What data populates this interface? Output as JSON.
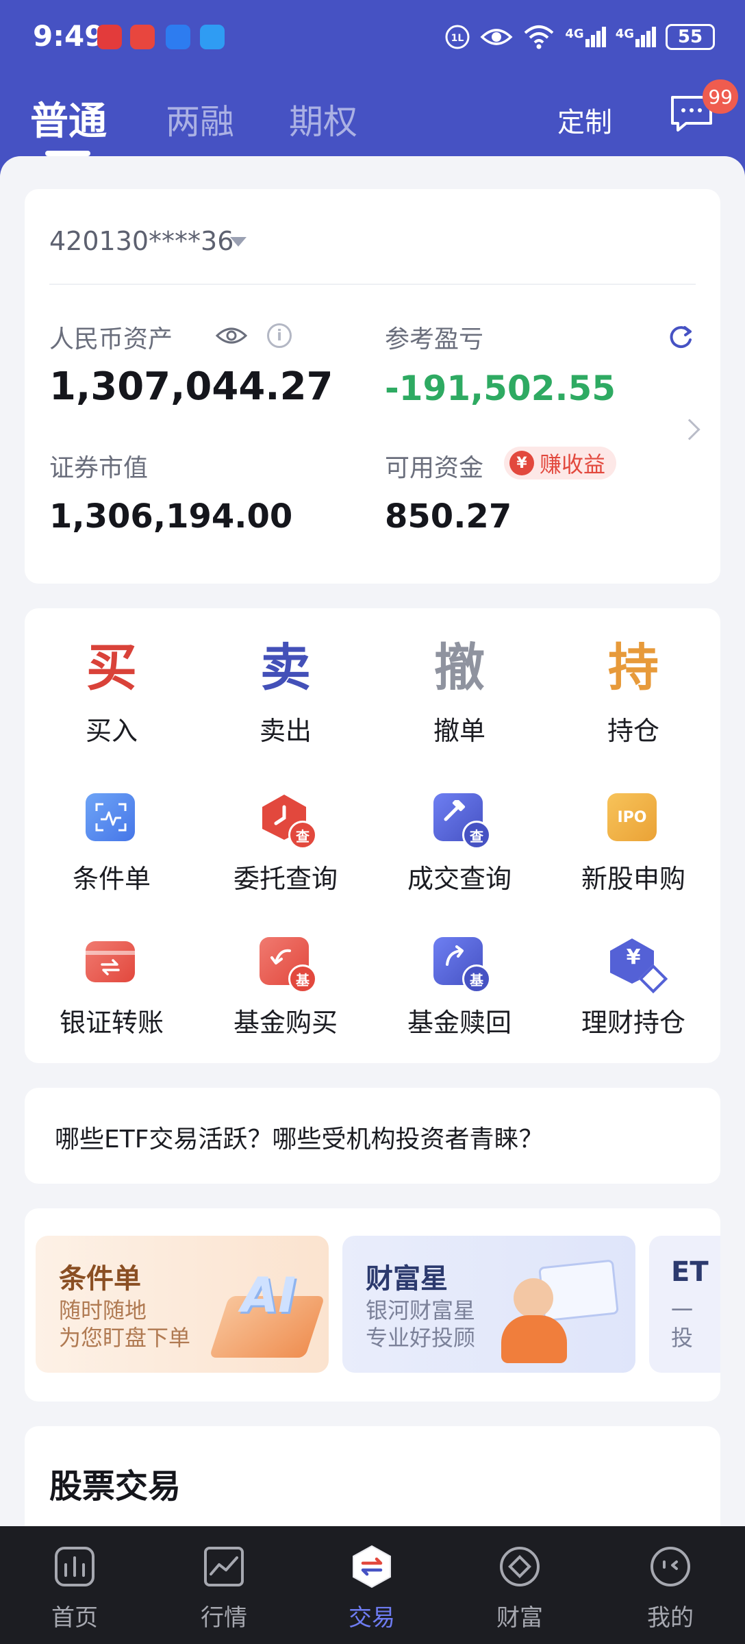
{
  "status_bar": {
    "time": "9:49",
    "battery": "55",
    "network_1": "4G",
    "network_2": "4G"
  },
  "header": {
    "tabs": [
      {
        "label": "普通",
        "active": true
      },
      {
        "label": "两融",
        "active": false
      },
      {
        "label": "期权",
        "active": false
      }
    ],
    "custom_label": "定制",
    "message_badge": "99"
  },
  "account": {
    "number": "420130****36",
    "rmb_assets_label": "人民币资产",
    "rmb_assets_value": "1,307,044.27",
    "pnl_label": "参考盈亏",
    "pnl_value": "-191,502.55",
    "securities_label": "证券市值",
    "securities_value": "1,306,194.00",
    "available_label": "可用资金",
    "available_value": "850.27",
    "earn_label": "赚收益",
    "earn_icon": "¥",
    "info_icon": "i"
  },
  "functions": {
    "trade": [
      {
        "char": "买",
        "label": "买入",
        "color": "#d94239"
      },
      {
        "char": "卖",
        "label": "卖出",
        "color": "#4350b8"
      },
      {
        "char": "撤",
        "label": "撤单",
        "color": "#8f939f"
      },
      {
        "char": "持",
        "label": "持仓",
        "color": "#e79a3a"
      }
    ],
    "row2": [
      {
        "label": "条件单",
        "icon": "conditional-order-icon"
      },
      {
        "label": "委托查询",
        "icon": "order-query-icon",
        "sub": "查"
      },
      {
        "label": "成交查询",
        "icon": "deal-query-icon",
        "sub": "查"
      },
      {
        "label": "新股申购",
        "icon": "ipo-icon",
        "text": "IPO"
      }
    ],
    "row3": [
      {
        "label": "银证转账",
        "icon": "bank-transfer-icon"
      },
      {
        "label": "基金购买",
        "icon": "fund-buy-icon",
        "sub": "基"
      },
      {
        "label": "基金赎回",
        "icon": "fund-redeem-icon",
        "sub": "基"
      },
      {
        "label": "理财持仓",
        "icon": "wealth-holding-icon",
        "text": "¥"
      }
    ]
  },
  "question": "哪些ETF交易活跃？哪些受机构投资者青睐？",
  "banners": [
    {
      "title": "条件单",
      "line1": "随时随地",
      "line2": "为您盯盘下单",
      "art": "AI"
    },
    {
      "title": "财富星",
      "line1": "银河财富星",
      "line2": "专业好投顾"
    },
    {
      "title": "ET",
      "line1": "一",
      "line2": "投"
    }
  ],
  "stock_section_title": "股票交易",
  "bottom_nav": [
    {
      "label": "首页",
      "active": false
    },
    {
      "label": "行情",
      "active": false
    },
    {
      "label": "交易",
      "active": true
    },
    {
      "label": "财富",
      "active": false
    },
    {
      "label": "我的",
      "active": false
    }
  ],
  "colors": {
    "brand": "#4652c3",
    "loss": "#2eaa62",
    "accent_red": "#e2483d",
    "nav_active": "#6e7cf2"
  }
}
